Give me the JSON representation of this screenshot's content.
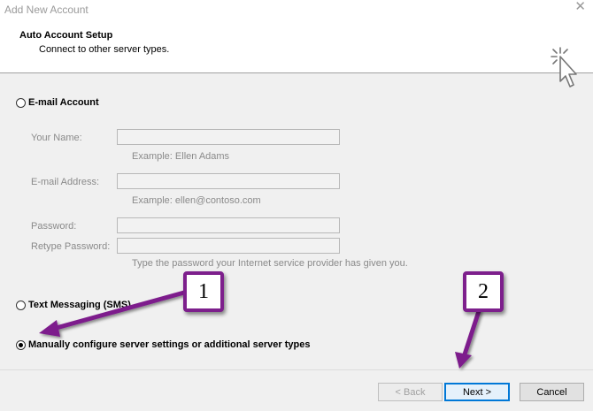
{
  "window": {
    "title": "Add New Account",
    "close_glyph": "✕"
  },
  "header": {
    "title": "Auto Account Setup",
    "subtitle": "Connect to other server types."
  },
  "options": {
    "email": {
      "label": "E-mail Account",
      "fields": {
        "name": {
          "label": "Your Name:",
          "value": "",
          "hint": "Example: Ellen Adams"
        },
        "email": {
          "label": "E-mail Address:",
          "value": "",
          "hint": "Example: ellen@contoso.com"
        },
        "password": {
          "label": "Password:",
          "value": ""
        },
        "retype": {
          "label": "Retype Password:",
          "value": "",
          "hint": "Type the password your Internet service provider has given you."
        }
      }
    },
    "sms": {
      "label": "Text Messaging (SMS)"
    },
    "manual": {
      "label": "Manually configure server settings or additional server types",
      "selected": true
    }
  },
  "footer": {
    "back": "< Back",
    "next": "Next >",
    "cancel": "Cancel"
  },
  "annotations": {
    "callout1": "1",
    "callout2": "2",
    "color": "#7d1f8c"
  },
  "icons": {
    "header": "cursor-click-icon"
  }
}
